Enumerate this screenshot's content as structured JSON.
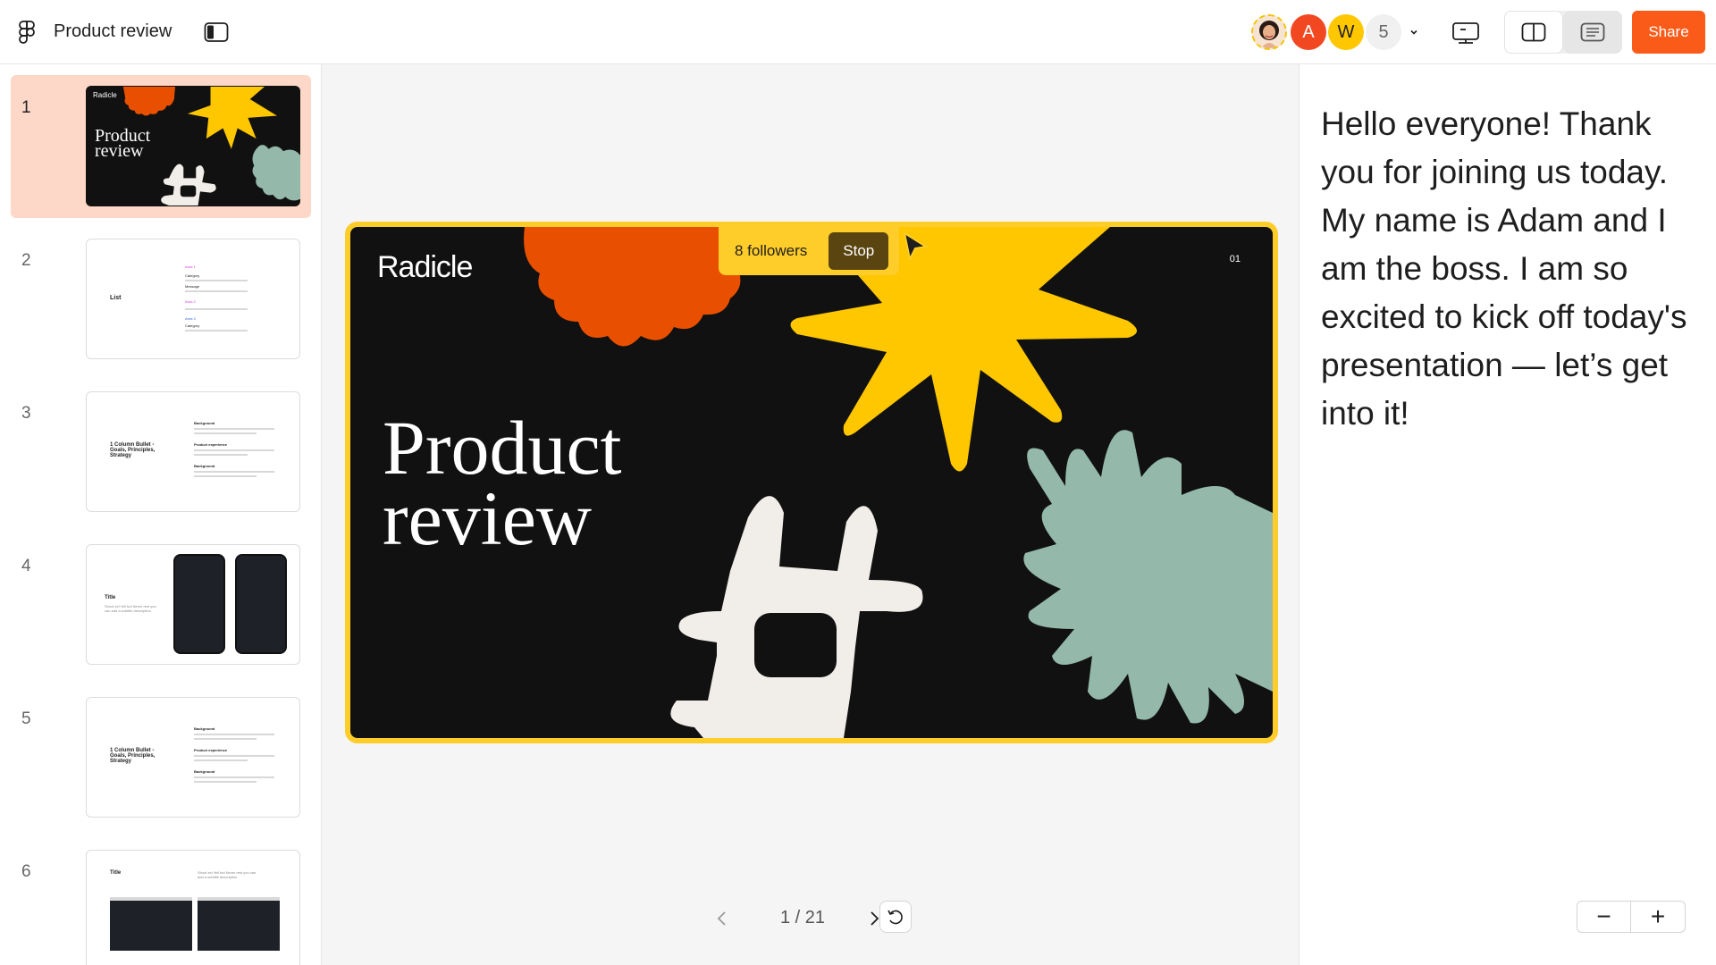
{
  "app": {
    "file_title": "Product review"
  },
  "topbar": {
    "avatars": [
      {
        "kind": "photo",
        "label": ""
      },
      {
        "kind": "initial",
        "label": "A",
        "color": "#f24822"
      },
      {
        "kind": "initial",
        "label": "W",
        "color": "#ffc700"
      }
    ],
    "extra_count": "5",
    "share_label": "Share",
    "icons": [
      "figma-logo-icon",
      "panel-toggle-icon",
      "chevron-down-icon",
      "present-screen-icon",
      "split-view-icon",
      "notes-view-icon"
    ]
  },
  "sidebar": {
    "slides": [
      {
        "number": "1",
        "selected": true,
        "brand": "Radicle",
        "title_line1": "Product",
        "title_line2": "review"
      },
      {
        "number": "2",
        "selected": false,
        "heading": "List",
        "items": [
          "Area 1",
          "Category",
          "Message",
          "Area 2",
          "Area 3",
          "Category"
        ]
      },
      {
        "number": "3",
        "selected": false,
        "heading": "1 Column Bullet - Goals, Principles, Strategy",
        "items": [
          "Background",
          "Product experience",
          "Background"
        ]
      },
      {
        "number": "4",
        "selected": false,
        "heading": "Title",
        "sub": "Shoot ex't fell but Never rest you can add a subtitle description"
      },
      {
        "number": "5",
        "selected": false,
        "heading": "1 Column Bullet - Goals, Principles, Strategy",
        "items": [
          "Background",
          "Product experience",
          "Background"
        ]
      },
      {
        "number": "6",
        "selected": false,
        "heading": "Title",
        "sub": "Shoot ex't fell but Never rest you can add a subtitle description"
      }
    ]
  },
  "slide": {
    "brand": "Radicle",
    "number": "01",
    "title_line1": "Product",
    "title_line2": "review",
    "colors": {
      "frame": "#ffcd29",
      "background": "#111111",
      "orange": "#e85000",
      "yellow": "#ffc700",
      "sage": "#94b9ab",
      "cream": "#f1ede9"
    }
  },
  "follow": {
    "followers_text": "8 followers",
    "stop_label": "Stop"
  },
  "pager": {
    "text": "1 / 21"
  },
  "notes": {
    "text": "Hello everyone! Thank you for joining us today. My name is Adam and I am the boss. I am so excited to kick off today's presentation — let’s get into it!"
  },
  "zoom": {
    "minus": "−",
    "plus": "+"
  }
}
